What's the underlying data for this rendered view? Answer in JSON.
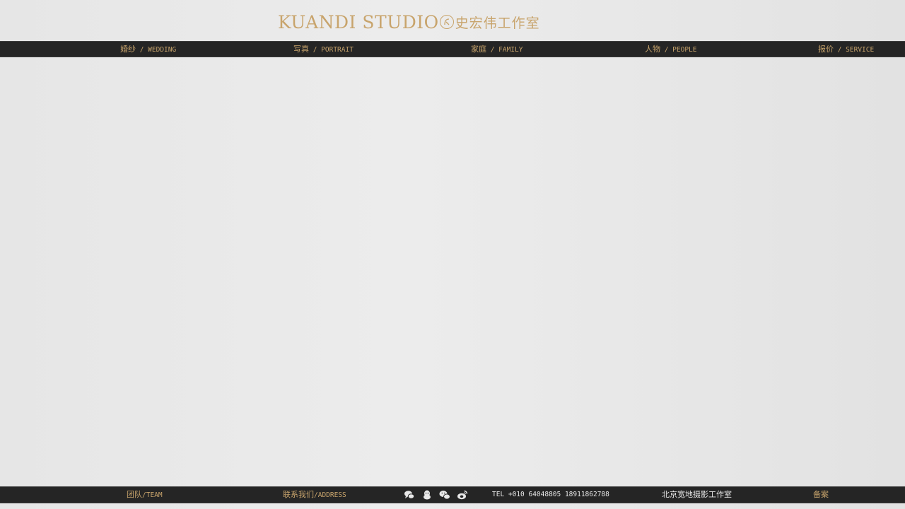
{
  "logo": {
    "en": "KUANDI STUDIO",
    "cn": "史宏伟工作室",
    "color": "#c8a46c"
  },
  "nav": [
    {
      "cn": "婚纱",
      "en": "WEDDING"
    },
    {
      "cn": "写真",
      "en": "PORTRAIT"
    },
    {
      "cn": "家庭",
      "en": "FAMILY"
    },
    {
      "cn": "人物",
      "en": "PEOPLE"
    },
    {
      "cn": "报价",
      "en": "SERVICE"
    }
  ],
  "nav_separator": " / ",
  "footer": {
    "team": {
      "cn": "团队",
      "en": "TEAM"
    },
    "address": {
      "cn": "联系我们",
      "en": "ADDRESS"
    },
    "socials": [
      "chat-bubbles-icon",
      "qq-penguin-icon",
      "wechat-icon",
      "weibo-icon"
    ],
    "tel": "TEL +010 64048805 18911862788",
    "studio_name": "北京宽地摄影工作室",
    "record": "备案"
  },
  "colors": {
    "bar_bg": "#252525",
    "accent": "#c8a46c",
    "light_text": "#e8e8e8"
  }
}
